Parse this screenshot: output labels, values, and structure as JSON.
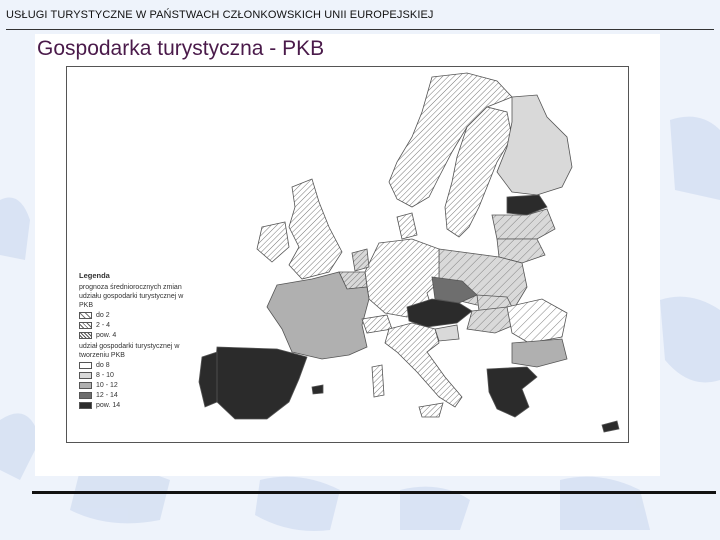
{
  "header": {
    "text": "USŁUGI  TURYSTYCZNE W PAŃSTWACH CZŁONKOWSKICH UNII EUROPEJSKIEJ"
  },
  "slide": {
    "title": "Gospodarka turystyczna - PKB"
  },
  "legend": {
    "title": "Legenda",
    "section1": "prognoza średniorocznych zmian udziału gospodarki turystycznej w PKB",
    "section1_items": [
      "do 2",
      "2 - 4",
      "pow. 4"
    ],
    "section2": "udział gospodarki turystycznej w tworzeniu PKB",
    "section2_items": [
      "do 8",
      "8 - 10",
      "10 - 12",
      "12 - 14",
      "pow. 14"
    ]
  },
  "colors": {
    "title": "#4a1a4a",
    "level_1": "#ffffff",
    "level_2": "#d9d9d9",
    "level_3": "#b0b0b0",
    "level_4": "#6e6e6e",
    "level_5": "#2b2b2b",
    "background": "#eef3fb"
  },
  "map": {
    "countries": [
      {
        "name": "Norway",
        "level": 1,
        "pattern": "hatch-2"
      },
      {
        "name": "Sweden",
        "level": 1,
        "pattern": "hatch-2"
      },
      {
        "name": "Finland",
        "level": 2,
        "pattern": null
      },
      {
        "name": "Estonia",
        "level": 5,
        "pattern": null
      },
      {
        "name": "Latvia",
        "level": 2,
        "pattern": "hatch-1"
      },
      {
        "name": "Lithuania",
        "level": 2,
        "pattern": "hatch-1"
      },
      {
        "name": "Poland",
        "level": 2,
        "pattern": "hatch-1"
      },
      {
        "name": "Germany",
        "level": 1,
        "pattern": "hatch-2"
      },
      {
        "name": "Denmark",
        "level": 1,
        "pattern": "hatch-2"
      },
      {
        "name": "United Kingdom",
        "level": 1,
        "pattern": "hatch-2"
      },
      {
        "name": "Ireland",
        "level": 1,
        "pattern": "hatch-2"
      },
      {
        "name": "France",
        "level": 3,
        "pattern": null
      },
      {
        "name": "Spain",
        "level": 5,
        "pattern": null
      },
      {
        "name": "Portugal",
        "level": 5,
        "pattern": null
      },
      {
        "name": "Italy",
        "level": 1,
        "pattern": "hatch-2"
      },
      {
        "name": "Czech Republic",
        "level": 4,
        "pattern": null
      },
      {
        "name": "Slovakia",
        "level": 2,
        "pattern": "hatch-1"
      },
      {
        "name": "Austria",
        "level": 5,
        "pattern": null
      },
      {
        "name": "Hungary",
        "level": 2,
        "pattern": "hatch-1"
      },
      {
        "name": "Slovenia",
        "level": 2,
        "pattern": null
      },
      {
        "name": "Romania",
        "level": 1,
        "pattern": "hatch-1"
      },
      {
        "name": "Bulgaria",
        "level": 3,
        "pattern": null
      },
      {
        "name": "Greece",
        "level": 5,
        "pattern": null
      },
      {
        "name": "Cyprus",
        "level": 5,
        "pattern": null
      },
      {
        "name": "Switzerland",
        "level": 1,
        "pattern": "hatch-2"
      },
      {
        "name": "Belgium",
        "level": 2,
        "pattern": "hatch-2"
      },
      {
        "name": "Netherlands",
        "level": 2,
        "pattern": "hatch-2"
      }
    ]
  }
}
